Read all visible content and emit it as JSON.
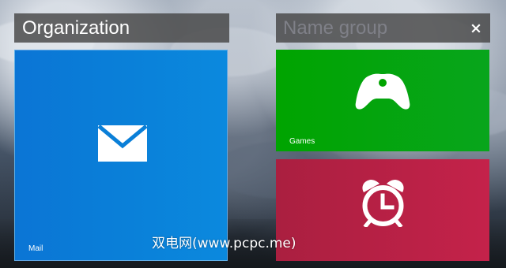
{
  "colors": {
    "mail_tile": "#0A7FD8",
    "games_tile": "#00A400",
    "alarm_tile": "#C4224A",
    "header_background": "#464646",
    "placeholder_text": "#7F8088"
  },
  "left_group": {
    "title": "Organization"
  },
  "right_group": {
    "name_placeholder": "Name group",
    "clear_icon": "close-icon"
  },
  "tiles": [
    {
      "label": "Mail",
      "icon": "mail-icon"
    },
    {
      "label": "Games",
      "icon": "game-controller-icon"
    },
    {
      "label": "",
      "icon": "alarm-clock-icon"
    }
  ],
  "watermark": {
    "text": "双电网(www.pcpc.me)"
  }
}
